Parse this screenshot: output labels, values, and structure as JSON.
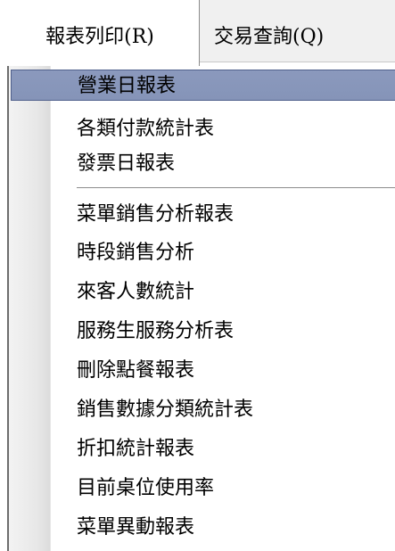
{
  "menubar": {
    "items": [
      {
        "label": "報表列印(R)"
      },
      {
        "label": "交易查詢(Q)"
      }
    ]
  },
  "dropdown": {
    "group1": [
      {
        "label": "營業日報表"
      },
      {
        "label": "各類付款統計表"
      },
      {
        "label": "發票日報表"
      }
    ],
    "group2": [
      {
        "label": "菜單銷售分析報表"
      },
      {
        "label": "時段銷售分析"
      },
      {
        "label": "來客人數統計"
      },
      {
        "label": "服務生服務分析表"
      },
      {
        "label": "刪除點餐報表"
      },
      {
        "label": "銷售數據分類統計表"
      },
      {
        "label": "折扣統計報表"
      },
      {
        "label": "目前桌位使用率"
      },
      {
        "label": "菜單異動報表"
      }
    ]
  }
}
